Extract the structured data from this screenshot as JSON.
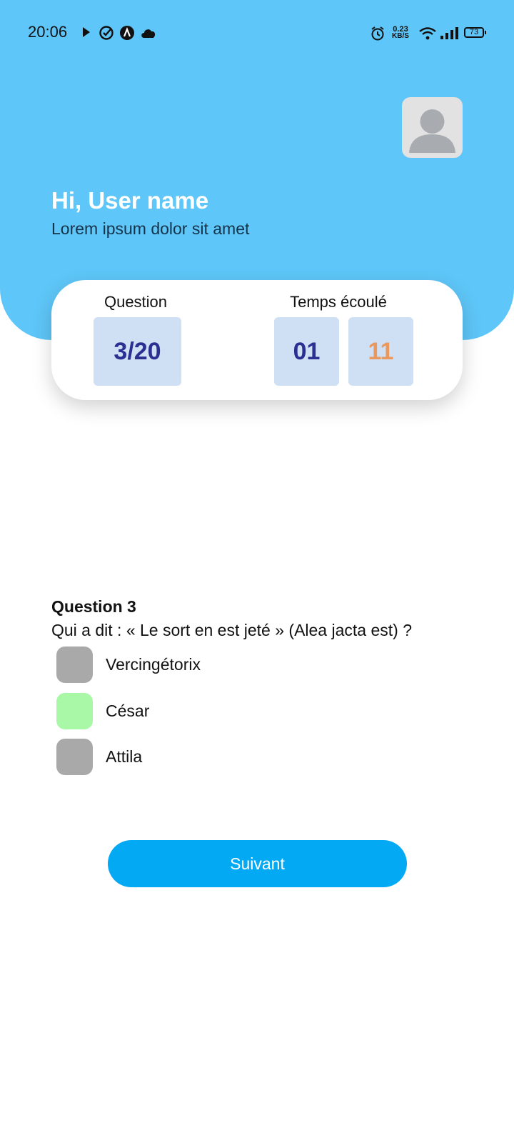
{
  "status_bar": {
    "time": "20:06",
    "net_speed_value": "0.23",
    "net_speed_unit": "KB/S",
    "battery": "73",
    "left_icons": [
      "play-icon",
      "check-circle-icon",
      "app-a-icon",
      "cloud-icon"
    ],
    "right_icons": [
      "alarm-icon",
      "wifi-icon",
      "signal-icon",
      "battery-icon"
    ]
  },
  "header": {
    "greeting": "Hi, User name",
    "subtitle": "Lorem ipsum dolor sit amet",
    "avatar_icon": "user-avatar-icon"
  },
  "stats": {
    "question_label": "Question",
    "question_value": "3/20",
    "time_label": "Temps écoulé",
    "time_minutes": "01",
    "time_seconds": "11"
  },
  "question": {
    "title": "Question 3",
    "text": "Qui a dit : « Le sort en est jeté » (Alea jacta est) ?",
    "options": [
      {
        "label": "Vercingétorix",
        "selected": false
      },
      {
        "label": "César",
        "selected": true
      },
      {
        "label": "Attila",
        "selected": false
      }
    ]
  },
  "actions": {
    "next_label": "Suivant"
  },
  "colors": {
    "header_bg": "#5ec6f8",
    "stat_box_bg": "#cfdff4",
    "question_value": "#2b2f92",
    "minutes": "#2b2f92",
    "seconds": "#e9995d",
    "option_default": "#a9a9a9",
    "option_selected": "#a8f8a8",
    "button": "#04a9f4"
  }
}
